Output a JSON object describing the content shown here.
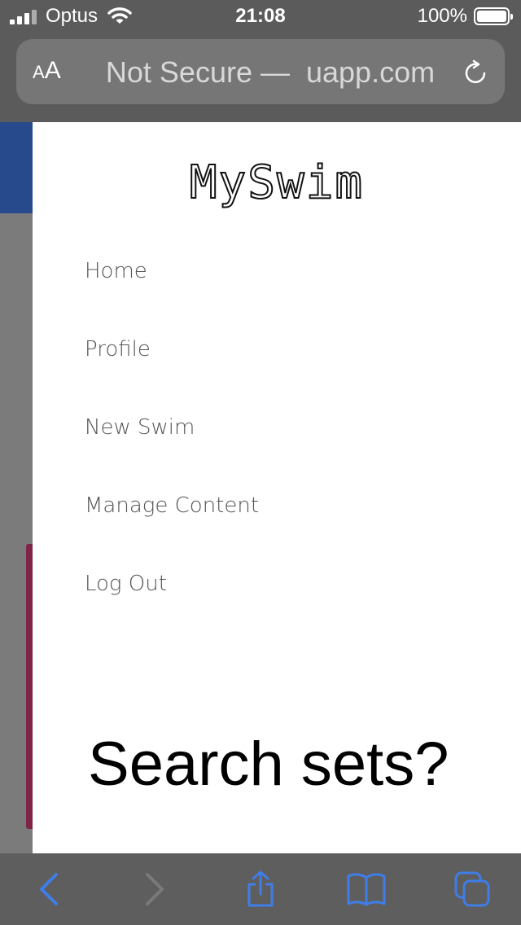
{
  "status_bar": {
    "carrier": "Optus",
    "time": "21:08",
    "battery": "100%"
  },
  "address_bar": {
    "text_size_label": "AA",
    "url": "Not Secure —  uapp.com"
  },
  "drawer": {
    "logo": "MySwim",
    "nav_items": [
      "Home",
      "Profile",
      "New Swim",
      "Manage Content",
      "Log Out"
    ]
  },
  "main": {
    "heading": "Search sets?"
  },
  "colors": {
    "accent_blue": "#3f7de8",
    "page_blue": "#264a8c",
    "page_pink": "#7f2347"
  },
  "toolbar": {
    "icons": [
      "back-icon",
      "forward-icon",
      "share-icon",
      "bookmarks-icon",
      "tabs-icon"
    ]
  }
}
